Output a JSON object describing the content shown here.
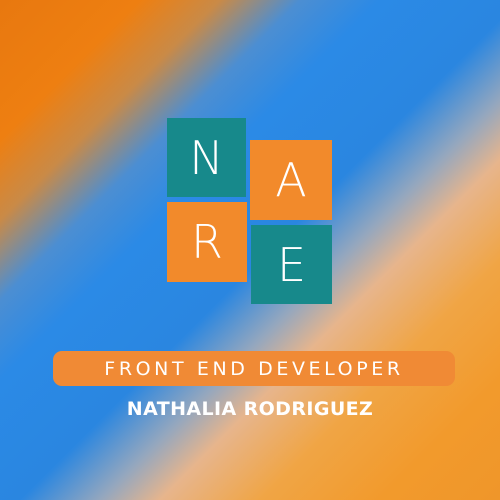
{
  "logo": {
    "letters": [
      "N",
      "A",
      "R",
      "E"
    ],
    "colors": {
      "teal": "#17898b",
      "orange": "#f28a2b"
    }
  },
  "subtitle": "FRONT END DEVELOPER",
  "name": "NATHALIA RODRIGUEZ",
  "background": {
    "colors": [
      "#e8780f",
      "#2b8ae6",
      "#e7b58c",
      "#f29a2c"
    ]
  }
}
